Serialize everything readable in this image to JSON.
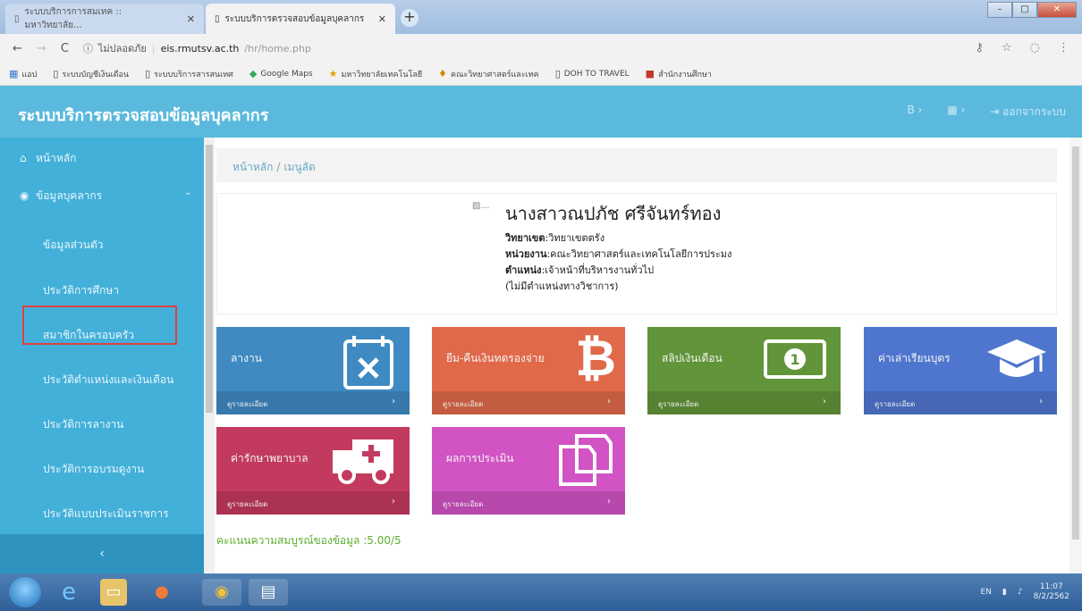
{
  "browser": {
    "tabs": [
      {
        "title": "ระบบบริการการสมเทค :: มหาวิทยาลัย..."
      },
      {
        "title": "ระบบบริการตรวจสอบข้อมูลบุคลากร"
      }
    ],
    "nav": {
      "back": "←",
      "forward": "→",
      "reload": "C"
    },
    "url": {
      "security": "ไม่ปลอดภัย",
      "host": "eis.rmutsv.ac.th",
      "path": "/hr/home.php"
    },
    "bookmarks": [
      {
        "icon": "apps-icon",
        "label": "แอป"
      },
      {
        "icon": "page-icon",
        "label": "ระบบบัญชีเงินเดือน"
      },
      {
        "icon": "page-icon",
        "label": "ระบบบริการสารสนเทศ"
      },
      {
        "icon": "maps-icon",
        "label": "Google Maps"
      },
      {
        "icon": "rmut-icon",
        "label": "มหาวิทยาลัยเทคโนโลยี"
      },
      {
        "icon": "faculty-icon",
        "label": "คณะวิทยาศาสตร์และเทค"
      },
      {
        "icon": "page-icon",
        "label": "DOH TO TRAVEL"
      },
      {
        "icon": "ms-icon",
        "label": "สำนักงานศึกษา"
      }
    ]
  },
  "app": {
    "title": "ระบบบริการตรวจสอบข้อมูลบุคลากร",
    "header_actions": {
      "logout": "ออกจากระบบ"
    },
    "sidebar": {
      "home": "หน้าหลัก",
      "group": "ข้อมูลบุคลากร",
      "items": [
        "ข้อมูลส่วนตัว",
        "ประวัติการศึกษา",
        "สมาชิกในครอบครัว",
        "ประวัติตำแหน่งและเงินเดือน",
        "ประวัติการลางาน",
        "ประวัติการอบรมดูงาน",
        "ประวัติแบบประเมินราชการ"
      ],
      "collapse": "‹"
    },
    "breadcrumb": {
      "home": "หน้าหลัก",
      "sep": "/",
      "current": "เมนูลัด"
    },
    "profile": {
      "avatar_alt": "…",
      "name": "นางสาวณปภัช ศรีจันทร์ทอง",
      "campus_label": "วิทยาเขต",
      "campus_value": ":วิทยาเขตตรัง",
      "unit_label": "หน่วยงาน",
      "unit_value": ":คณะวิทยาศาสตร์และเทคโนโลยีการประมง",
      "position_label": "ตำแหน่ง",
      "position_value": ":เจ้าหน้าที่บริหารงานทั่วไป",
      "academic": "(ไม่มีตำแหน่งทางวิชาการ)"
    },
    "cards": [
      {
        "title": "ลางาน",
        "footer": "ดูรายละเอียด",
        "color": "#3f8ac2",
        "icon": "calendar-x-icon"
      },
      {
        "title": "ยืม-คืนเงินทดรองจ่าย",
        "footer": "ดูรายละเอียด",
        "color": "#e0694a",
        "icon": "bitcoin-icon"
      },
      {
        "title": "สลิปเงินเดือน",
        "footer": "ดูรายละเอียด",
        "color": "#62943a",
        "icon": "money-icon"
      },
      {
        "title": "ค่าเล่าเรียนบุตร",
        "footer": "ดูรายละเอียด",
        "color": "#4f76cf",
        "icon": "graduation-cap-icon"
      },
      {
        "title": "ค่ารักษาพยาบาล",
        "footer": "ดูรายละเอียด",
        "color": "#c33a5f",
        "icon": "ambulance-icon"
      },
      {
        "title": "ผลการประเมิน",
        "footer": "ดูรายละเอียด",
        "color": "#d153c4",
        "icon": "documents-icon"
      }
    ],
    "score": "คะแนนความสมบูรณ์ของข้อมูล :5.00/5"
  },
  "taskbar": {
    "lang": "EN",
    "time": "11:07",
    "date": "8/2/2562"
  }
}
